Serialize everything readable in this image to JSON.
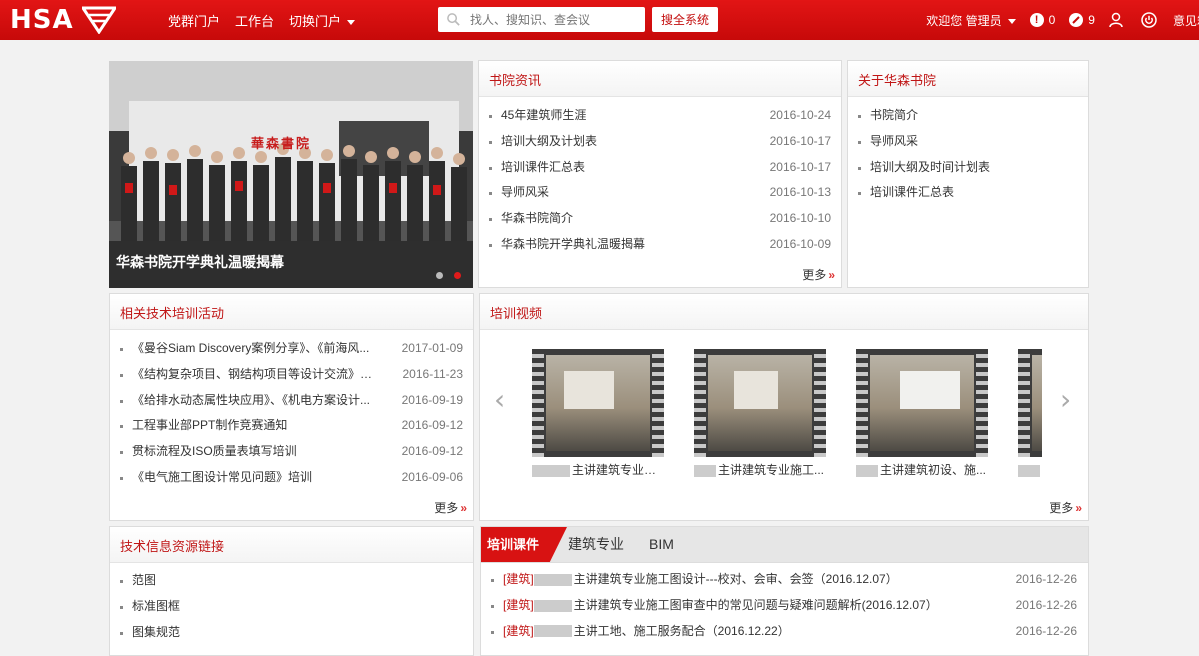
{
  "header": {
    "logo_text": "HSA",
    "nav": [
      "党群门户",
      "工作台",
      "切换门户"
    ],
    "search_placeholder": "找人、搜知识、查会议",
    "search_button": "搜全系统",
    "welcome": "欢迎您 管理员",
    "alerts_count": "0",
    "notices_count": "9",
    "feedback": "意见箱"
  },
  "carousel": {
    "banner_title": "華森書院",
    "caption": "华森书院开学典礼温暖揭幕"
  },
  "news": {
    "title": "书院资讯",
    "items": [
      {
        "text": "45年建筑师生涯",
        "date": "2016-10-24"
      },
      {
        "text": "培训大纲及计划表",
        "date": "2016-10-17"
      },
      {
        "text": "培训课件汇总表",
        "date": "2016-10-17"
      },
      {
        "text": "导师风采",
        "date": "2016-10-13"
      },
      {
        "text": "华森书院简介",
        "date": "2016-10-10"
      },
      {
        "text": "华森书院开学典礼温暖揭幕",
        "date": "2016-10-09"
      }
    ],
    "more": "更多"
  },
  "about": {
    "title": "关于华森书院",
    "items": [
      "书院简介",
      "导师风采",
      "培训大纲及时间计划表",
      "培训课件汇总表"
    ]
  },
  "activities": {
    "title": "相关技术培训活动",
    "items": [
      {
        "text": "《曼谷Siam Discovery案例分享》、《前海风...",
        "date": "2017-01-09"
      },
      {
        "text": "《结构复杂项目、钢结构项目等设计交流》讲座",
        "date": "2016-11-23"
      },
      {
        "text": "《给排水动态属性块应用》、《机电方案设计...",
        "date": "2016-09-19"
      },
      {
        "text": "工程事业部PPT制作竞赛通知",
        "date": "2016-09-12"
      },
      {
        "text": "贯标流程及ISO质量表填写培训",
        "date": "2016-09-12"
      },
      {
        "text": "《电气施工图设计常见问题》培训",
        "date": "2016-09-06"
      }
    ],
    "more": "更多"
  },
  "videos": {
    "title": "培训视频",
    "items": [
      {
        "caption": "主讲建筑专业施工..."
      },
      {
        "caption": "主讲建筑专业施工..."
      },
      {
        "caption": "主讲建筑初设、施..."
      },
      {
        "caption": "主"
      }
    ],
    "more": "更多"
  },
  "links": {
    "title": "技术信息资源链接",
    "items": [
      "范图",
      "标准图框",
      "图集规范"
    ]
  },
  "courseware": {
    "tabs": [
      "培训课件",
      "建筑专业",
      "BIM"
    ],
    "items": [
      {
        "tag": "[建筑]",
        "text": "主讲建筑专业施工图设计---校对、会审、会签（2016.12.07）",
        "date": "2016-12-26"
      },
      {
        "tag": "[建筑]",
        "text": "主讲建筑专业施工图审查中的常见问题与疑难问题解析(2016.12.07）",
        "date": "2016-12-26"
      },
      {
        "tag": "[建筑]",
        "text": "主讲工地、施工服务配合（2016.12.22）",
        "date": "2016-12-26"
      }
    ]
  },
  "colors": {
    "brand_red": "#d81212",
    "title_red": "#c01616"
  }
}
